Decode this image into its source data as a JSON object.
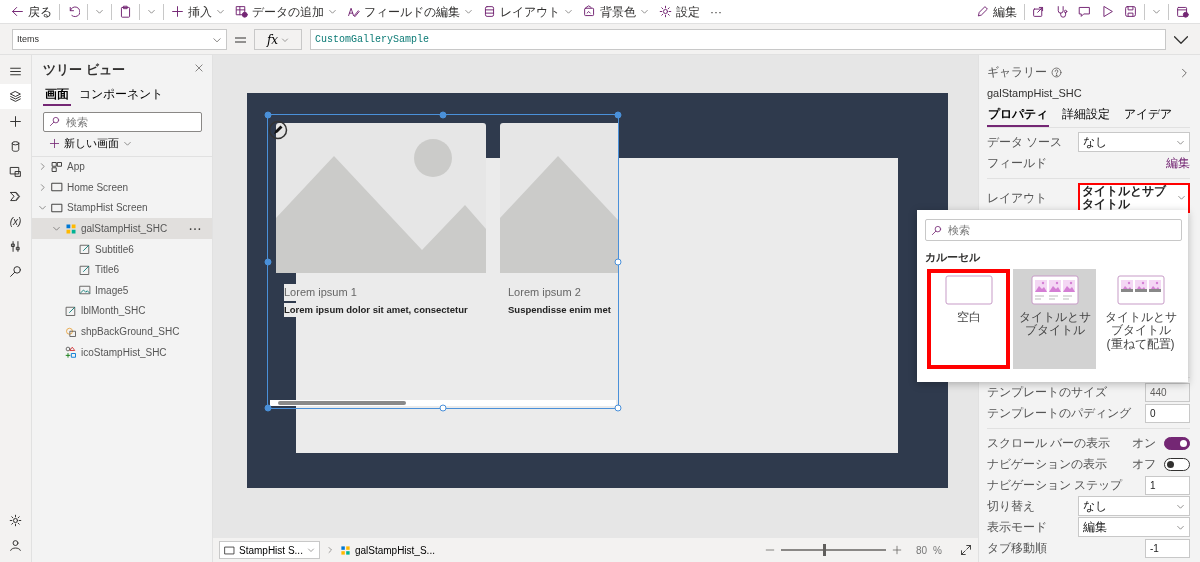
{
  "toolbar": {
    "left_groups": [
      [
        {
          "label": "戻る",
          "has_menu": false
        }
      ],
      [
        {
          "has_menu": true
        }
      ],
      [
        {
          "has_menu": true
        }
      ],
      [
        {
          "label": "挿入",
          "has_menu": true
        },
        {
          "label": "データの追加",
          "has_menu": true
        },
        {
          "label": "フィールドの編集",
          "has_menu": true
        },
        {
          "label": "レイアウト",
          "has_menu": true
        },
        {
          "label": "背景色",
          "has_menu": true
        },
        {
          "label": "設定",
          "has_menu": false
        },
        {
          "label": "···",
          "has_menu": false
        }
      ]
    ],
    "right_groups": [
      [
        {
          "label": "編集",
          "has_menu": false
        }
      ],
      [
        {
          "has_menu": false
        },
        {
          "has_menu": false
        },
        {
          "has_menu": false
        },
        {
          "has_menu": false
        },
        {
          "has_menu": true
        }
      ],
      [
        {
          "has_menu": false
        }
      ]
    ]
  },
  "formula_bar": {
    "property": "Items",
    "function_label": "fx",
    "formula": "CustomGallerySample"
  },
  "rail": {
    "top": [
      {
        "selected": false
      },
      {
        "selected": true
      },
      {
        "selected": false
      },
      {
        "selected": false
      },
      {
        "selected": false
      },
      {
        "selected": false
      },
      {
        "label": "(x)",
        "selected": false
      },
      {
        "selected": false
      },
      {
        "selected": false
      }
    ],
    "bottom": [
      {
        "selected": false
      },
      {
        "selected": false
      }
    ]
  },
  "tree_view": {
    "title": "ツリー ビュー",
    "tabs": [
      {
        "label": "画面",
        "selected": true
      },
      {
        "label": "コンポーネント",
        "selected": false
      }
    ],
    "search": {
      "placeholder": "検索"
    },
    "new_screen": "新しい画面",
    "nodes": [
      {
        "label": "App",
        "kind": "app",
        "expanded": false,
        "selected": false
      },
      {
        "label": "Home Screen",
        "kind": "screen",
        "expanded": false,
        "selected": false
      },
      {
        "label": "StampHist Screen",
        "kind": "screen",
        "expanded": true,
        "selected": false,
        "children": [
          {
            "label": "galStampHist_SHC",
            "kind": "gallery",
            "expanded": true,
            "selected": true,
            "children": [
              {
                "label": "Subtitle6",
                "kind": "label",
                "selected": false
              },
              {
                "label": "Title6",
                "kind": "label",
                "selected": false
              },
              {
                "label": "Image5",
                "kind": "image",
                "selected": false
              }
            ]
          },
          {
            "label": "lblMonth_SHC",
            "kind": "label",
            "selected": false
          },
          {
            "label": "shpBackGround_SHC",
            "kind": "shape",
            "selected": false
          },
          {
            "label": "icoStampHist_SHC",
            "kind": "icon",
            "selected": false
          }
        ]
      }
    ]
  },
  "canvas": {
    "cards": [
      {
        "title": "Lorem ipsum 1",
        "subtitle": "Lorem ipsum dolor sit amet, consectetur"
      },
      {
        "title": "Lorem ipsum 2",
        "subtitle": "Suspendisse enim met"
      }
    ]
  },
  "status_bar": {
    "screen_tab": "StampHist S...",
    "breadcrumb": "galStampHist_S...",
    "zoom": {
      "level": 0.41,
      "value": "80",
      "unit": "%"
    }
  },
  "properties": {
    "type": "ギャラリー",
    "name": "galStampHist_SHC",
    "tabs": [
      {
        "label": "プロパティ",
        "selected": true
      },
      {
        "label": "詳細設定",
        "selected": false
      },
      {
        "label": "アイデア",
        "selected": false
      }
    ],
    "sections": [
      {
        "rows": [
          {
            "kind": "dropdown",
            "label": "データ ソース",
            "value": "なし",
            "annotated": false
          },
          {
            "kind": "link",
            "label": "フィールド",
            "value": "編集"
          }
        ]
      },
      {
        "rows": [
          {
            "kind": "dropdown",
            "label": "レイアウト",
            "value": "タイトルとサブタイトル",
            "annotated": true
          }
        ]
      },
      {
        "rows": [
          {
            "kind": "field",
            "label": "テンプレートのサイズ",
            "value": "440",
            "disabled": true
          },
          {
            "kind": "field",
            "label": "テンプレートのパディング",
            "value": "0",
            "disabled": false
          }
        ]
      },
      {
        "rows": [
          {
            "kind": "toggle",
            "label": "スクロール バーの表示",
            "state": "オン",
            "on": true
          },
          {
            "kind": "toggle",
            "label": "ナビゲーションの表示",
            "state": "オフ",
            "on": false
          },
          {
            "kind": "field",
            "label": "ナビゲーション ステップ",
            "value": "1",
            "disabled": false
          },
          {
            "kind": "dropdown",
            "label": "切り替え",
            "value": "なし",
            "annotated": false
          },
          {
            "kind": "dropdown",
            "label": "表示モード",
            "value": "編集",
            "annotated": false
          },
          {
            "kind": "field",
            "label": "タブ移動順",
            "value": "-1",
            "disabled": false
          }
        ]
      }
    ]
  },
  "layout_picker": {
    "search": {
      "placeholder": "検索"
    },
    "heading": "カルーセル",
    "options": [
      {
        "kind": "blank",
        "label": "空白",
        "selected": false,
        "annotated": true
      },
      {
        "kind": "cards",
        "label": "タイトルとサブタイトル",
        "selected": true,
        "annotated": false
      },
      {
        "kind": "overlay",
        "label": "タイトルとサブタイトル (重ねて配置)",
        "selected": false,
        "annotated": false
      }
    ]
  }
}
